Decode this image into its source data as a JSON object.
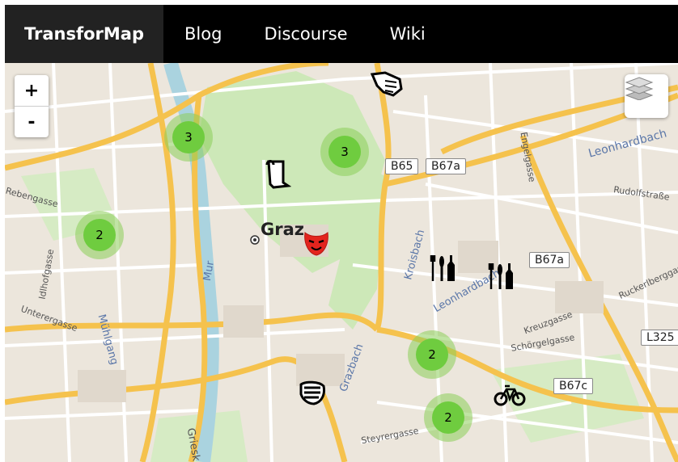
{
  "navbar": {
    "brand": "TransforMap",
    "links": [
      "Blog",
      "Discourse",
      "Wiki"
    ]
  },
  "map": {
    "city": "Graz",
    "zoom_in": "+",
    "zoom_out": "-",
    "clusters": [
      "3",
      "3",
      "2",
      "2",
      "2"
    ],
    "road_shields": [
      "B65",
      "B67a",
      "B67a",
      "L325",
      "B67c"
    ],
    "streets": [
      "Leonhardbach",
      "Rudolfstraße",
      "Engelgasse",
      "Rebengasse",
      "Idlhofgasse",
      "Unterergasse",
      "Mühlgang",
      "Mur",
      "Kroisbach",
      "Leonhardbach",
      "Kreuzgasse",
      "Schörgelgasse",
      "Ruckerlberggasse",
      "Steyrergasse",
      "Griesk",
      "Kroisbach",
      "Mur",
      "Grazbach"
    ],
    "icons": [
      "hand-icon",
      "scroll-icon",
      "theater-mask-icon",
      "restaurant-icon",
      "restaurant-icon",
      "bicycle-icon",
      "fist-icon",
      "location-dot-icon",
      "layers-icon"
    ],
    "colors": {
      "cluster": "#6fcc3f",
      "cluster_halo": "#8ccd5a",
      "major_road": "#f5c24d",
      "river": "#aad3df",
      "park": "#cde8b8",
      "mask": "#e3241e"
    }
  }
}
